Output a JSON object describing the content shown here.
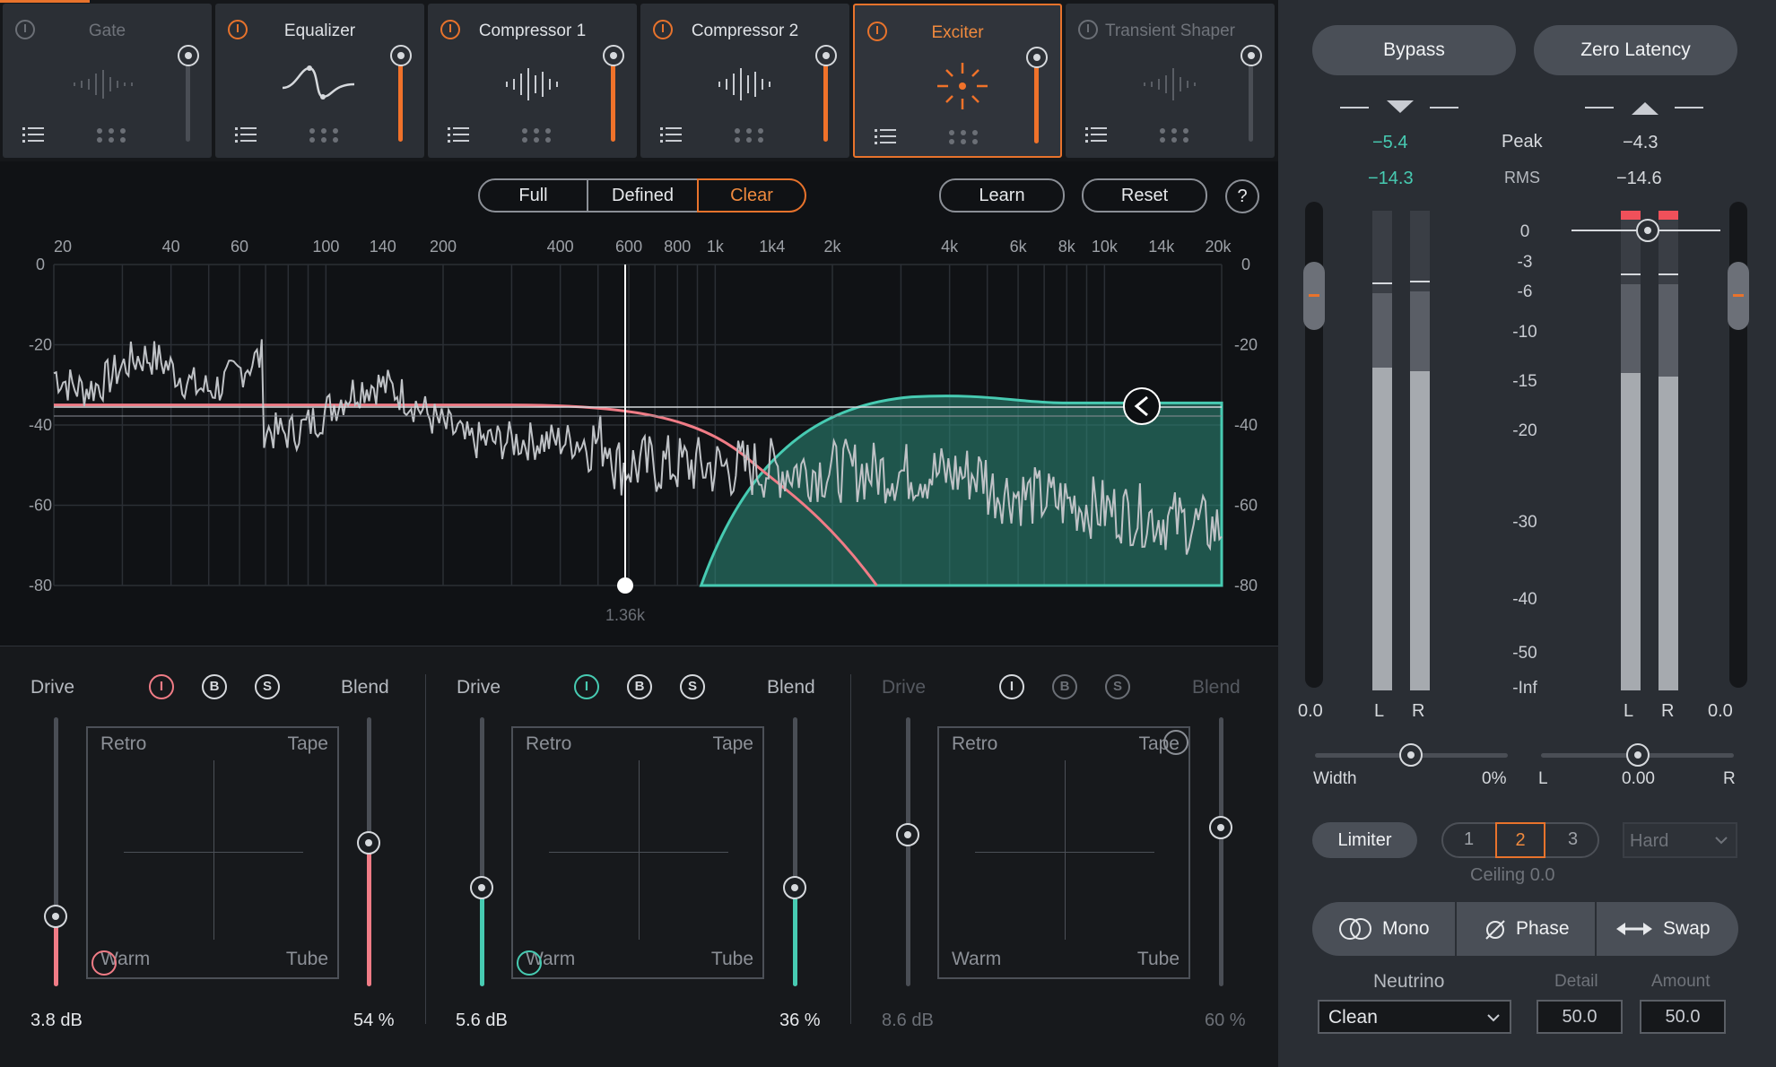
{
  "modules": [
    {
      "name": "Gate",
      "enabled": false,
      "dim": true,
      "fill": 0,
      "icon": "gate-waveform-icon"
    },
    {
      "name": "Equalizer",
      "enabled": true,
      "dim": false,
      "fill": 1,
      "icon": "eq-curve-icon"
    },
    {
      "name": "Compressor 1",
      "enabled": true,
      "dim": false,
      "fill": 1,
      "icon": "compressor-waveform-icon"
    },
    {
      "name": "Compressor 2",
      "enabled": true,
      "dim": false,
      "fill": 1,
      "icon": "compressor-waveform-icon"
    },
    {
      "name": "Exciter",
      "enabled": true,
      "dim": false,
      "fill": 1,
      "active": true,
      "icon": "exciter-burst-icon"
    },
    {
      "name": "Transient Shaper",
      "enabled": false,
      "dim": true,
      "fill": 0,
      "icon": "transient-waveform-icon"
    }
  ],
  "modes": [
    "Full",
    "Defined",
    "Clear"
  ],
  "selected_mode": "Clear",
  "learn_label": "Learn",
  "reset_label": "Reset",
  "help_label": "?",
  "graph": {
    "freq_labels": [
      "20",
      "40",
      "60",
      "100",
      "140",
      "200",
      "400",
      "600",
      "800",
      "1k",
      "1k4",
      "2k",
      "4k",
      "6k",
      "8k",
      "10k",
      "14k",
      "20k"
    ],
    "db_labels": [
      "0",
      "-20",
      "-40",
      "-60",
      "-80"
    ],
    "crossover_label": "1.36k"
  },
  "bands": [
    {
      "drive_label": "Drive",
      "blend_label": "Blend",
      "drive_value": "3.8 dB",
      "blend_value": "54 %",
      "drive": 0.26,
      "blend": 0.54,
      "color": "#f07c86",
      "dim": false,
      "retro": "Retro",
      "tape": "Tape",
      "warm": "Warm",
      "tube": "Tube",
      "mode_buttons": [
        "I",
        "B",
        "S"
      ]
    },
    {
      "drive_label": "Drive",
      "blend_label": "Blend",
      "drive_value": "5.6 dB",
      "blend_value": "36 %",
      "drive": 0.36,
      "blend": 0.36,
      "color": "#47cbb2",
      "dim": false,
      "retro": "Retro",
      "tape": "Tape",
      "warm": "Warm",
      "tube": "Tube",
      "mode_buttons": [
        "I",
        "B",
        "S"
      ]
    },
    {
      "drive_label": "Drive",
      "blend_label": "Blend",
      "drive_value": "8.6 dB",
      "blend_value": "60 %",
      "drive": 0.57,
      "blend": 0.6,
      "color": "#6b6f76",
      "dim": true,
      "retro": "Retro",
      "tape": "Tape",
      "warm": "Warm",
      "tube": "Tube",
      "mode_buttons": [
        "I",
        "B",
        "S"
      ]
    }
  ],
  "right": {
    "bypass_label": "Bypass",
    "zero_latency_label": "Zero Latency",
    "peak_label": "Peak",
    "rms_label": "RMS",
    "in_peak": "−5.4",
    "in_rms": "−14.3",
    "out_peak": "−4.3",
    "out_rms": "−14.6",
    "scale": [
      "0",
      "-3",
      "-6",
      "-10",
      "-15",
      "-20",
      "-30",
      "-40",
      "-50",
      "-Inf"
    ],
    "in_gain": "0.0",
    "out_gain": "0.0",
    "l_label": "L",
    "r_label": "R",
    "width_label": "Width",
    "width_value": "0%",
    "pan_l": "L",
    "pan_value": "0.00",
    "pan_r": "R",
    "limiter_label": "Limiter",
    "limiter_modes": [
      "1",
      "2",
      "3"
    ],
    "limiter_selected": "2",
    "limiter_type": "Hard",
    "ceiling_label": "Ceiling 0.0",
    "mono_label": "Mono",
    "phase_label": "Phase",
    "swap_label": "Swap",
    "neutrino_label": "Neutrino",
    "neutrino_value": "Clean",
    "detail_label": "Detail",
    "detail_value": "50.0",
    "amount_label": "Amount",
    "amount_value": "50.0"
  },
  "colors": {
    "accent": "#e8732c",
    "teal": "#47cbb2",
    "pink": "#f07c86"
  }
}
